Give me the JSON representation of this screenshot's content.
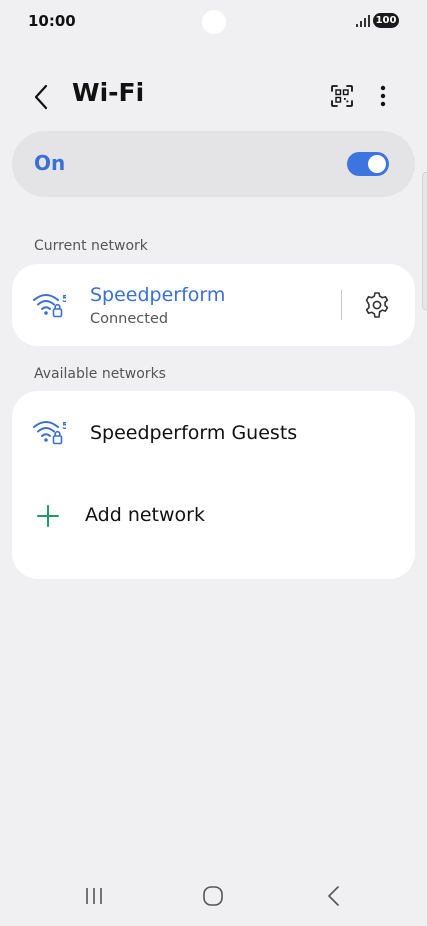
{
  "status_bar": {
    "time": "10:00",
    "battery": "100"
  },
  "header": {
    "title": "Wi-Fi",
    "back_icon": "chevron-left-icon",
    "qr_icon": "qr-scan-icon",
    "more_icon": "more-vertical-icon"
  },
  "wifi_toggle": {
    "label": "On",
    "state": "on",
    "accent_color": "#3e74e0"
  },
  "current_network": {
    "header": "Current network",
    "name": "Speedperform",
    "status": "Connected",
    "band": "5",
    "icon": "wifi-locked-icon",
    "settings_icon": "gear-icon"
  },
  "available_networks": {
    "header": "Available networks",
    "items": [
      {
        "name": "Speedperform Guests",
        "band": "5",
        "icon": "wifi-locked-icon"
      }
    ],
    "add_label": "Add network",
    "add_icon": "plus-icon"
  },
  "navbar": {
    "recents_icon": "recents-icon",
    "home_icon": "home-icon",
    "back_icon": "back-icon"
  }
}
